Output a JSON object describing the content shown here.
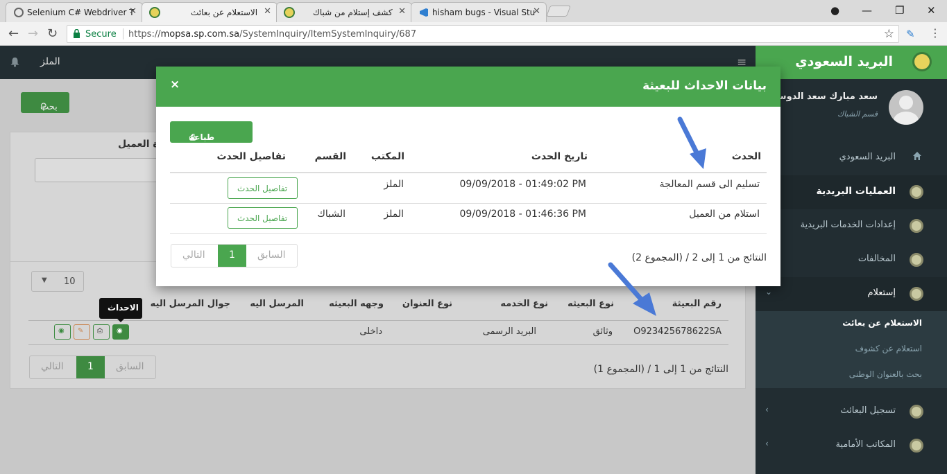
{
  "browser": {
    "tabs": [
      {
        "title": "Selenium C# Webdriver T",
        "active": false
      },
      {
        "title": "الاستعلام عن بعائث",
        "active": true
      },
      {
        "title": "كشف إستلام من شباك",
        "active": false
      },
      {
        "title": "hisham bugs - Visual Stu",
        "active": false
      }
    ],
    "secure_label": "Secure",
    "url_scheme": "https://",
    "url_host": "mopsa.sp.com.sa",
    "url_path": "/SystemInquiry/ItemSystemInquiry/687"
  },
  "topnav": {
    "city": "الملز"
  },
  "brand": {
    "name": "البريد السعودي"
  },
  "user": {
    "name": "سعد مبارك سعد الدوسري",
    "department": "قسم الشباك"
  },
  "sidebar": {
    "items": [
      {
        "label": "البريد السعودي",
        "icon": "home-icon"
      },
      {
        "label": "العمليات البريدية",
        "icon": "logo-icon"
      },
      {
        "label": "إعدادات الخدمات البريدية",
        "icon": "logo-icon"
      },
      {
        "label": "المخالفات",
        "icon": "logo-icon"
      },
      {
        "label": "إستعلام",
        "icon": "logo-icon"
      },
      {
        "label": "تسجيل البعائث",
        "icon": "logo-icon"
      },
      {
        "label": "المكاتب الأمامية",
        "icon": "logo-icon"
      }
    ],
    "subitems": [
      {
        "label": "الاستعلام عن بعائث",
        "active": true
      },
      {
        "label": "استعلام عن كشوف",
        "active": false
      },
      {
        "label": "بحث بالعنوان الوطنى",
        "active": false
      }
    ]
  },
  "background": {
    "search_button": "بحث",
    "client_label": "ة العميل",
    "page_size": "10",
    "table": {
      "headers": [
        "رقم البعيثة",
        "نوع البعيثه",
        "نوع الخدمه",
        "نوع العنوان",
        "وجهه البعيثه",
        "المرسل اليه",
        "جوال المرسل اليه"
      ],
      "row": {
        "number": "O923425678622SA",
        "type": "وثائق",
        "service": "البريد الرسمى",
        "dest": "داخلى"
      }
    },
    "tooltip": "الاحداث",
    "pager": {
      "prev": "السابق",
      "current": "1",
      "next": "التالي"
    },
    "total": "النتائج من 1 إلى 1 / (المجموع 1)"
  },
  "modal": {
    "title": "بيانات الاحداث للبعيثة",
    "close": "×",
    "print_button": "طباعة الاحداث",
    "headers": {
      "event": "الحدث",
      "date": "تاريخ الحدث",
      "office": "المكتب",
      "section": "القسم",
      "details": "تفاصيل الحدث"
    },
    "rows": [
      {
        "event": "تسليم الى قسم المعالجة",
        "date": "09/09/2018 - 01:49:02 PM",
        "office": "الملز",
        "section": "",
        "details_button": "تفاصيل الحدث"
      },
      {
        "event": "استلام من العميل",
        "date": "09/09/2018 - 01:46:36 PM",
        "office": "الملز",
        "section": "الشباك",
        "details_button": "تفاصيل الحدث"
      }
    ],
    "pager": {
      "prev": "السابق",
      "current": "1",
      "next": "التالي"
    },
    "total": "النتائج من 1 إلى 2 / (المجموع 2)"
  },
  "colors": {
    "accent": "#4aa64f",
    "sidebar": "#222d32",
    "annotation_arrow": "#4a79d6"
  }
}
